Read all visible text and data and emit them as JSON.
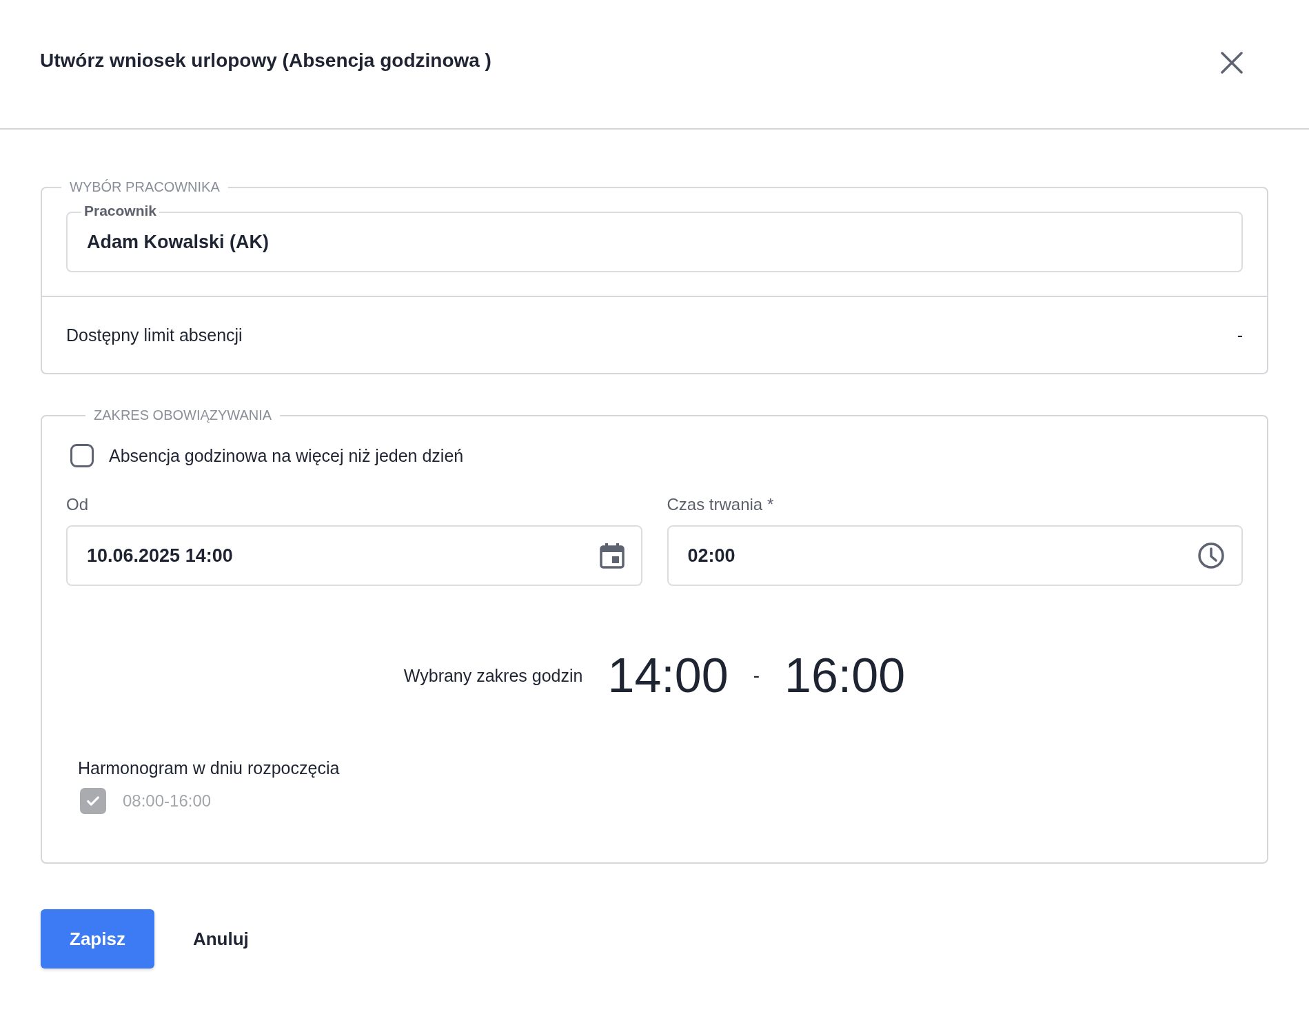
{
  "dialog": {
    "title": "Utwórz wniosek urlopowy (Absencja godzinowa )"
  },
  "employee_section": {
    "legend": "WYBÓR PRACOWNIKA",
    "field_label": "Pracownik",
    "value": "Adam Kowalski (AK)",
    "limit_label": "Dostępny limit absencji",
    "limit_value": "-"
  },
  "range_section": {
    "legend": "ZAKRES OBOWIĄZYWANIA",
    "multi_day": {
      "label": "Absencja godzinowa na więcej niż jeden dzień",
      "checked": false
    },
    "fields": [
      {
        "kind": "date",
        "label": "Od",
        "value": "10.06.2025 14:00"
      },
      {
        "kind": "time",
        "label": "Czas trwania *",
        "value": "02:00"
      }
    ],
    "selected_range": {
      "label": "Wybrany zakres godzin",
      "start": "14:00",
      "separator": "-",
      "end": "16:00"
    },
    "schedule": {
      "label": "Harmonogram w dniu rozpoczęcia",
      "items": [
        {
          "label": "08:00-16:00",
          "checked": true,
          "disabled": true
        }
      ]
    }
  },
  "buttons": [
    {
      "kind": "primary",
      "label": "Zapisz"
    },
    {
      "kind": "text",
      "label": "Anuluj"
    }
  ]
}
